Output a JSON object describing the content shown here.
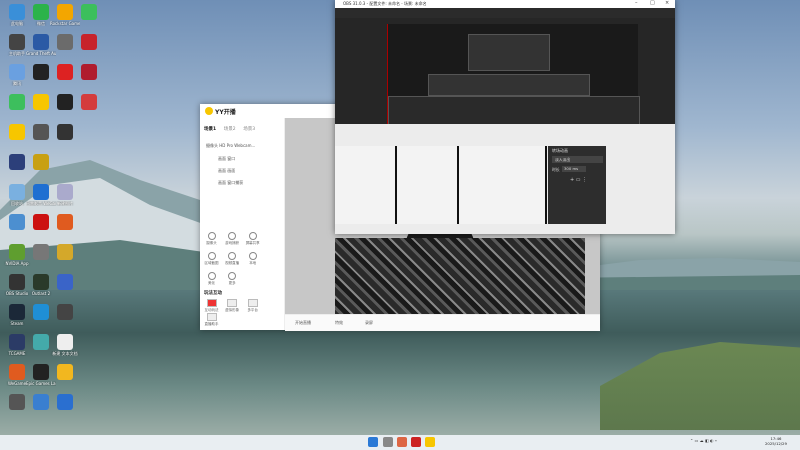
{
  "desktop_icons": [
    {
      "id": "i1",
      "label": "此电脑",
      "color": "#3a8fd8",
      "col": 0,
      "row": 0
    },
    {
      "id": "i2",
      "label": "微信",
      "color": "#2bb34a",
      "col": 1,
      "row": 0
    },
    {
      "id": "i3",
      "label": "Rockstar Games",
      "color": "#f3a600",
      "col": 2,
      "row": 0
    },
    {
      "id": "i4",
      "label": "",
      "color": "#3cbf5c",
      "col": 3,
      "row": 0
    },
    {
      "id": "i5",
      "label": "主机助手",
      "color": "#444",
      "col": 0,
      "row": 1
    },
    {
      "id": "i6",
      "label": "Grand Theft Auto V",
      "color": "#2b5aa5",
      "col": 1,
      "row": 1
    },
    {
      "id": "i7",
      "label": "",
      "color": "#6b6b6b",
      "col": 2,
      "row": 1
    },
    {
      "id": "i8",
      "label": "",
      "color": "#c7232b",
      "col": 3,
      "row": 1
    },
    {
      "id": "i9",
      "label": "腾讯",
      "color": "#6aa0e0",
      "col": 0,
      "row": 2
    },
    {
      "id": "i10",
      "label": "",
      "color": "#222",
      "col": 1,
      "row": 2
    },
    {
      "id": "i11",
      "label": "",
      "color": "#d22",
      "col": 2,
      "row": 2
    },
    {
      "id": "i12",
      "label": "",
      "color": "#b01c2e",
      "col": 3,
      "row": 2
    },
    {
      "id": "i13",
      "label": "",
      "color": "#3dbf5d",
      "col": 0,
      "row": 3
    },
    {
      "id": "i14",
      "label": "",
      "color": "#f7c600",
      "col": 1,
      "row": 3
    },
    {
      "id": "i15",
      "label": "",
      "color": "#222",
      "col": 2,
      "row": 3
    },
    {
      "id": "i16",
      "label": "",
      "color": "#d43c3c",
      "col": 3,
      "row": 3
    },
    {
      "id": "i17",
      "label": "",
      "color": "#f7c600",
      "col": 0,
      "row": 4
    },
    {
      "id": "i18",
      "label": "",
      "color": "#555",
      "col": 1,
      "row": 4
    },
    {
      "id": "i19",
      "label": "",
      "color": "#333",
      "col": 2,
      "row": 4
    },
    {
      "id": "i20",
      "label": "",
      "color": "#2c3f7a",
      "col": 0,
      "row": 5
    },
    {
      "id": "i21",
      "label": "",
      "color": "#c8a012",
      "col": 1,
      "row": 5
    },
    {
      "id": "i22",
      "label": "回收站",
      "color": "#7ab0e0",
      "col": 0,
      "row": 6
    },
    {
      "id": "i23",
      "label": "迅雷影音 WeGame",
      "color": "#1f6fd1",
      "col": 1,
      "row": 6
    },
    {
      "id": "i24",
      "label": "新建图片",
      "color": "#aac",
      "col": 2,
      "row": 6
    },
    {
      "id": "i25",
      "label": "",
      "color": "#4c8fd0",
      "col": 0,
      "row": 7
    },
    {
      "id": "i26",
      "label": "",
      "color": "#c11",
      "col": 1,
      "row": 7
    },
    {
      "id": "i27",
      "label": "",
      "color": "#e05b1f",
      "col": 2,
      "row": 7
    },
    {
      "id": "i28",
      "label": "NVIDIA App",
      "color": "#5f9e2f",
      "col": 0,
      "row": 8
    },
    {
      "id": "i29",
      "label": "",
      "color": "#777",
      "col": 1,
      "row": 8
    },
    {
      "id": "i30",
      "label": "",
      "color": "#d4a82a",
      "col": 2,
      "row": 8
    },
    {
      "id": "i31",
      "label": "OBS Studio",
      "color": "#333",
      "col": 0,
      "row": 9
    },
    {
      "id": "i32",
      "label": "Outlast 2",
      "color": "#2a3a2a",
      "col": 1,
      "row": 9
    },
    {
      "id": "i33",
      "label": "",
      "color": "#3a64c8",
      "col": 2,
      "row": 9
    },
    {
      "id": "i34",
      "label": "Steam",
      "color": "#1b2838",
      "col": 0,
      "row": 10
    },
    {
      "id": "i35",
      "label": "",
      "color": "#1f8fd6",
      "col": 1,
      "row": 10
    },
    {
      "id": "i36",
      "label": "",
      "color": "#444",
      "col": 2,
      "row": 10
    },
    {
      "id": "i37",
      "label": "TCGAME",
      "color": "#2b3b66",
      "col": 0,
      "row": 11
    },
    {
      "id": "i38",
      "label": "",
      "color": "#4aa",
      "col": 1,
      "row": 11
    },
    {
      "id": "i39",
      "label": "新建 文本文档",
      "color": "#eee",
      "col": 2,
      "row": 11
    },
    {
      "id": "i40",
      "label": "WeGame",
      "color": "#e05b1f",
      "col": 0,
      "row": 12
    },
    {
      "id": "i41",
      "label": "Epic Games Launcher",
      "color": "#222",
      "col": 1,
      "row": 12
    },
    {
      "id": "i42",
      "label": "",
      "color": "#f2b71f",
      "col": 2,
      "row": 12
    },
    {
      "id": "i43",
      "label": "",
      "color": "#555",
      "col": 0,
      "row": 13
    },
    {
      "id": "i44",
      "label": "",
      "color": "#3a7fd0",
      "col": 1,
      "row": 13
    },
    {
      "id": "i45",
      "label": "",
      "color": "#2a6fd0",
      "col": 2,
      "row": 13
    }
  ],
  "yy": {
    "brand": "YY开播",
    "tabs": [
      "场景1",
      "场景2",
      "场景3"
    ],
    "sources": [
      "摄像头 HD Pro Webcam...",
      "画面 窗口",
      "画面 画面",
      "画面 窗口捕获"
    ],
    "tools": [
      "摄像头",
      "游戏捕获",
      "屏幕共享",
      "区域截图",
      "视频直播",
      "本地",
      "美化",
      "更多"
    ],
    "activity_title": "玩法互动",
    "activities": [
      "互动玩法",
      "虚拟形象",
      "多平台",
      "直播助手"
    ],
    "bottom": [
      "开始直播",
      "特效",
      "录屏"
    ]
  },
  "obs": {
    "title": "OBS 31.0.3 - 配置文件: 未命名 - 场景: 未命名",
    "transition_title": "转场动画",
    "transition_value": "淡入淡出",
    "duration_label": "时长",
    "duration_value": "300 ms"
  },
  "clock": {
    "time": "17:46",
    "date": "2025/12/29"
  },
  "colors": {
    "yy_accent": "#f7c600",
    "obs_dark": "#2d2d2d"
  }
}
